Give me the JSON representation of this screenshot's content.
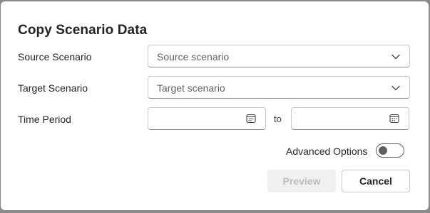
{
  "dialog": {
    "title": "Copy Scenario Data",
    "source": {
      "label": "Source Scenario",
      "placeholder": "Source scenario"
    },
    "target": {
      "label": "Target Scenario",
      "placeholder": "Target scenario"
    },
    "time_period": {
      "label": "Time Period",
      "from_value": "",
      "to_label": "to",
      "to_value": ""
    },
    "advanced": {
      "label": "Advanced Options",
      "enabled": false
    },
    "buttons": {
      "preview": "Preview",
      "preview_disabled": true,
      "cancel": "Cancel"
    }
  },
  "icons": {
    "dropdown": "chevron-down-icon",
    "date": "calendar-icon"
  },
  "colors": {
    "overlay": "#8a8a8a",
    "surface": "#ffffff",
    "text": "#242424",
    "disabled_bg": "#f0f0f0",
    "disabled_text": "#bdbdbd"
  }
}
